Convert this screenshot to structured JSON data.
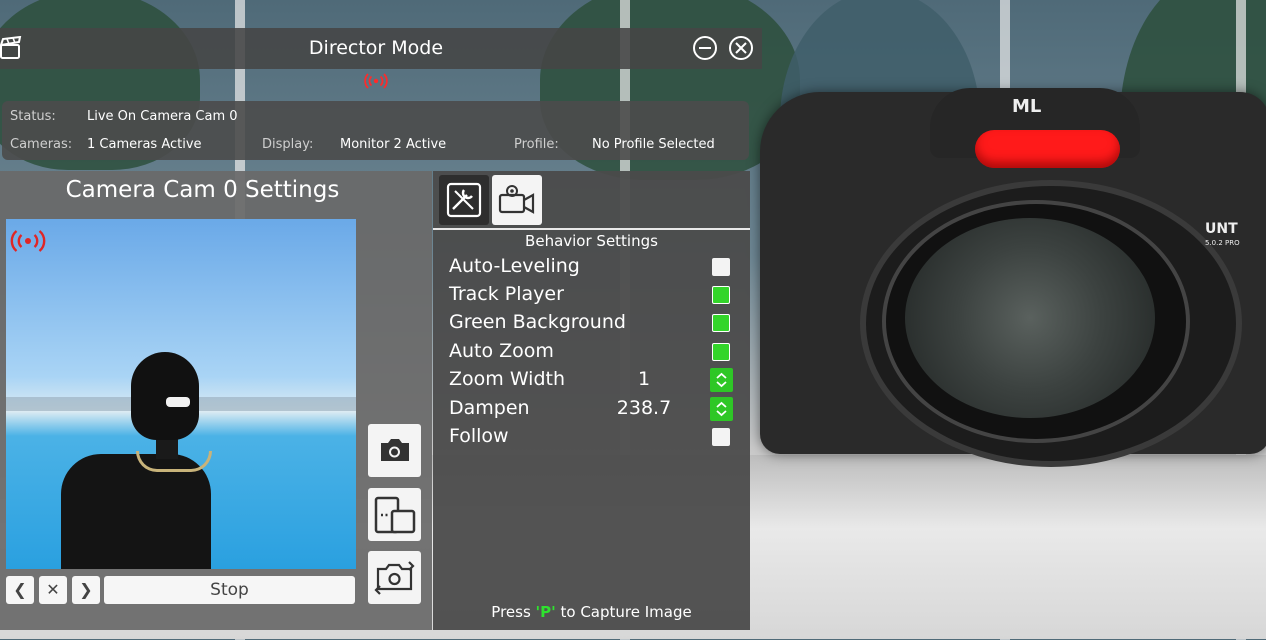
{
  "window": {
    "title": "Director Mode"
  },
  "status": {
    "status_label": "Status:",
    "status_value": "Live On Camera Cam 0",
    "cameras_label": "Cameras:",
    "cameras_value": "1 Cameras Active",
    "display_label": "Display:",
    "display_value": "Monitor 2 Active",
    "profile_label": "Profile:",
    "profile_value": "No Profile Selected"
  },
  "camera_panel": {
    "title": "Camera Cam 0 Settings",
    "prev_glyph": "❮",
    "clear_glyph": "✕",
    "next_glyph": "❯",
    "stop_label": "Stop"
  },
  "behavior": {
    "title": "Behavior Settings",
    "rows": [
      {
        "label": "Auto-Leveling",
        "type": "checkbox",
        "checked": false
      },
      {
        "label": "Track Player",
        "type": "checkbox",
        "checked": true
      },
      {
        "label": "Green Background",
        "type": "checkbox",
        "checked": true
      },
      {
        "label": "Auto Zoom",
        "type": "checkbox",
        "checked": true
      },
      {
        "label": "Zoom Width",
        "type": "number",
        "value": "1"
      },
      {
        "label": "Dampen",
        "type": "number",
        "value": "238.7"
      },
      {
        "label": "Follow",
        "type": "checkbox",
        "checked": false
      }
    ],
    "capture_prefix": "Press ",
    "capture_key": "'P'",
    "capture_suffix": " to Capture Image"
  },
  "scene": {
    "camera_logo": "ML",
    "camera_badge": "UNT",
    "camera_badge_sub": "5.0.2 PRO"
  },
  "colors": {
    "accent_green": "#33d52a",
    "live_red": "#ff2a2a",
    "record_button": "#ff1a1a"
  },
  "icons": {
    "window": "clapperboard-icon",
    "minimize": "minimize-circle-icon",
    "close": "close-circle-icon",
    "live": "broadcast-icon",
    "tools": [
      "camera-icon",
      "layout-split-icon",
      "switch-camera-icon"
    ],
    "tabs": [
      "tools-settings-icon",
      "video-settings-icon"
    ]
  }
}
